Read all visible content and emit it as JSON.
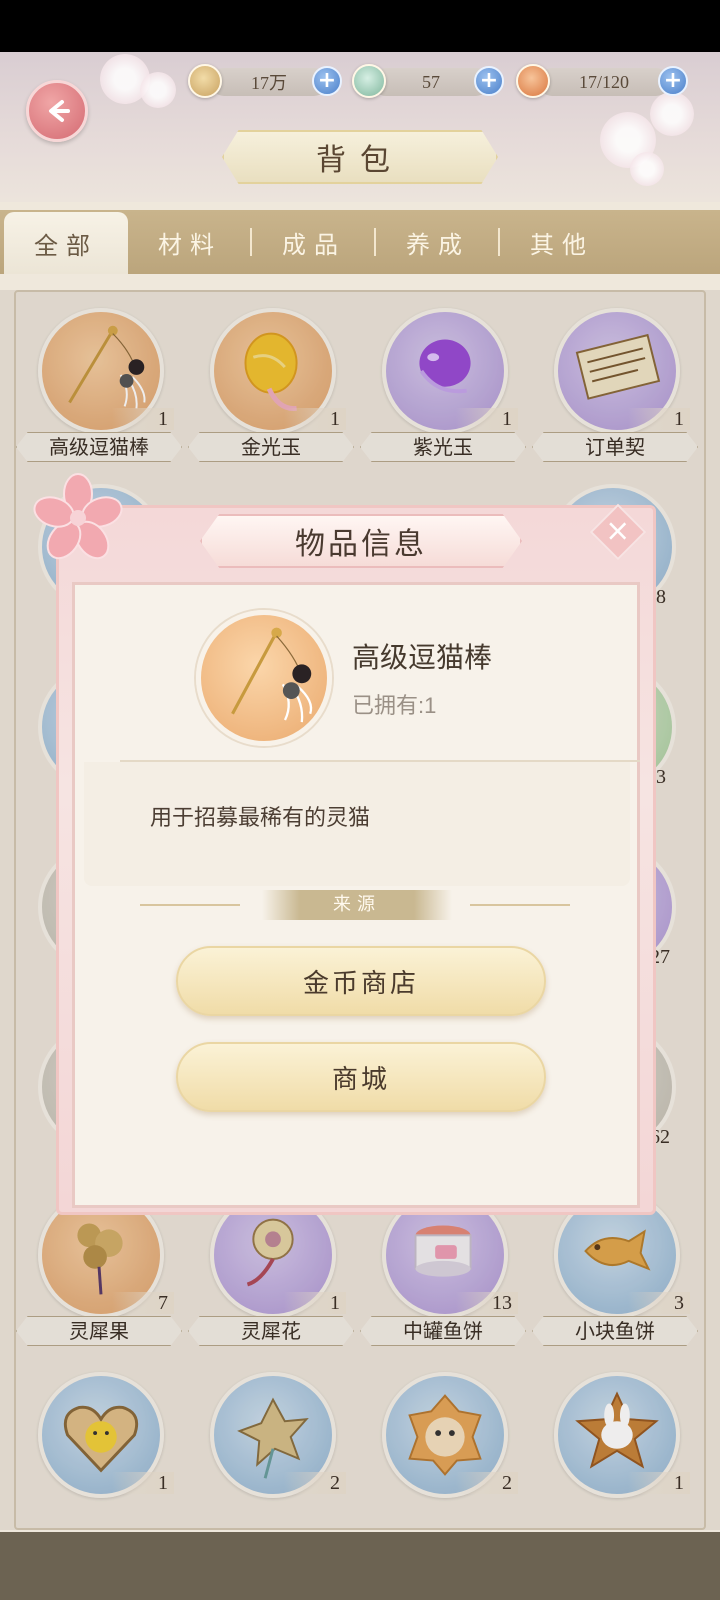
{
  "resources": [
    {
      "name": "paw-coin",
      "value": "17万",
      "color": "#d7b67a"
    },
    {
      "name": "fish-token",
      "value": "57",
      "color": "#8fc7b0"
    },
    {
      "name": "energy",
      "value": "17/120",
      "color": "#e09a58"
    }
  ],
  "header": {
    "title": "背包"
  },
  "tabs": [
    {
      "label": "全部",
      "active": true
    },
    {
      "label": "材料",
      "active": false
    },
    {
      "label": "成品",
      "active": false
    },
    {
      "label": "养成",
      "active": false
    },
    {
      "label": "其他",
      "active": false
    }
  ],
  "grid": {
    "row1": [
      {
        "name": "高级逗猫棒",
        "count": "1",
        "bg": "orange"
      },
      {
        "name": "金光玉",
        "count": "1",
        "bg": "orange"
      },
      {
        "name": "紫光玉",
        "count": "1",
        "bg": "purple"
      },
      {
        "name": "订单契",
        "count": "1",
        "bg": "purple"
      }
    ],
    "row_visible_counts": [
      "8",
      "3",
      "27",
      "562"
    ],
    "row7": [
      {
        "name": "灵犀果",
        "count": "7",
        "bg": "orange"
      },
      {
        "name": "灵犀花",
        "count": "1",
        "bg": "purple"
      },
      {
        "name": "中罐鱼饼",
        "count": "13",
        "bg": "purple"
      },
      {
        "name": "小块鱼饼",
        "count": "3",
        "bg": "blue"
      }
    ],
    "row8": [
      {
        "count": "1",
        "bg": "blue"
      },
      {
        "count": "2",
        "bg": "blue"
      },
      {
        "count": "2",
        "bg": "blue"
      },
      {
        "count": "1",
        "bg": "blue"
      }
    ]
  },
  "modal": {
    "title": "物品信息",
    "item_name": "高级逗猫棒",
    "owned_text": "已拥有:1",
    "description": "用于招募最稀有的灵猫",
    "source_label": "来源",
    "sources": [
      "金币商店",
      "商城"
    ]
  }
}
